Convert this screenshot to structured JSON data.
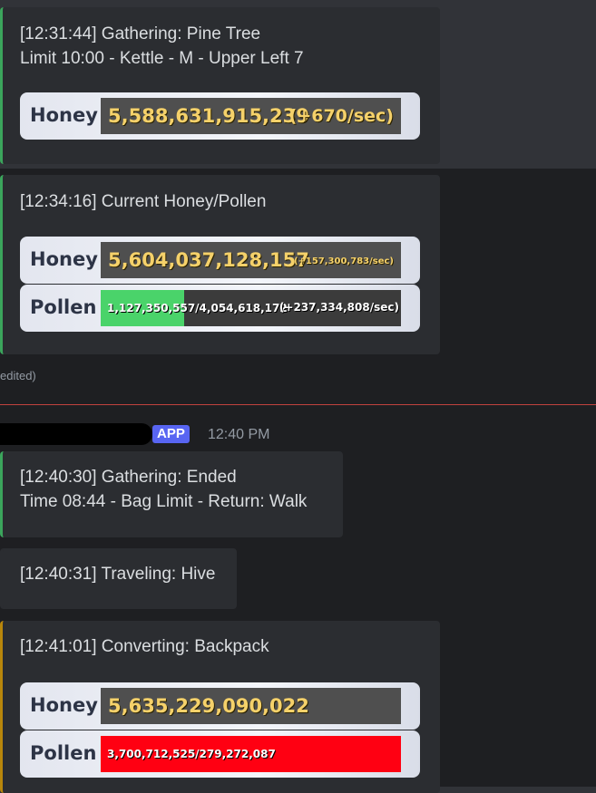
{
  "message1": {
    "line1": "[12:31:44] Gathering: Pine Tree",
    "line2": "Limit 10:00 - Kettle - M - Upper Left 7",
    "honey_label": "Honey",
    "honey_value": "5,588,631,915,239",
    "honey_rate": "(+670/sec)"
  },
  "message2": {
    "line1": "[12:34:16] Current Honey/Pollen",
    "honey_label": "Honey",
    "honey_value": "5,604,037,128,157",
    "honey_rate": "(+157,300,783/sec)",
    "pollen_label": "Pollen",
    "pollen_value": "1,127,350,557/4,054,618,172",
    "pollen_rate": "(+237,334,808/sec)",
    "pollen_fraction": 0.278
  },
  "edited_text": "edited)",
  "header": {
    "badge": "APP",
    "time": "12:40 PM"
  },
  "message3": {
    "line1": "[12:40:30] Gathering: Ended",
    "line2": "Time 08:44 - Bag Limit - Return: Walk"
  },
  "message4": {
    "line1": "[12:40:31] Traveling: Hive"
  },
  "message5": {
    "line1": "[12:41:01] Converting: Backpack",
    "honey_label": "Honey",
    "honey_value": "5,635,229,090,022",
    "pollen_label": "Pollen",
    "pollen_value": "3,700,712,525/279,272,087",
    "pollen_fraction": 1.0
  }
}
